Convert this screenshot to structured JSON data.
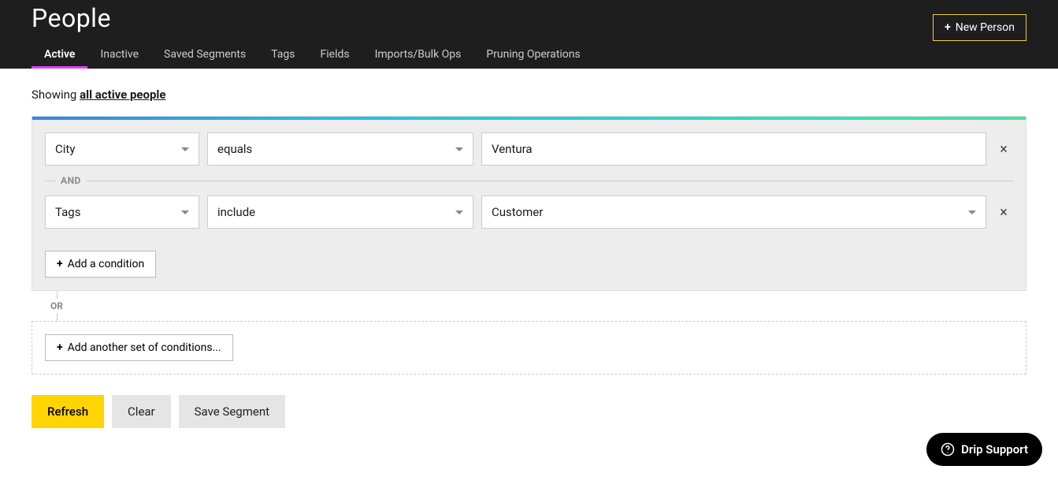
{
  "header": {
    "title": "People",
    "new_person_label": "New Person",
    "tabs": [
      "Active",
      "Inactive",
      "Saved Segments",
      "Tags",
      "Fields",
      "Imports/Bulk Ops",
      "Pruning Operations"
    ],
    "active_tab_index": 0
  },
  "showing": {
    "prefix": "Showing ",
    "link_text": "all active people"
  },
  "segment": {
    "conditions": [
      {
        "field": "City",
        "operator": "equals",
        "value": "Ventura",
        "value_type": "text"
      },
      {
        "field": "Tags",
        "operator": "include",
        "value": "Customer",
        "value_type": "dropdown"
      }
    ],
    "and_label": "AND",
    "or_label": "OR",
    "add_condition_label": "Add a condition",
    "add_set_label": "Add another set of conditions..."
  },
  "actions": {
    "refresh": "Refresh",
    "clear": "Clear",
    "save_segment": "Save Segment"
  },
  "support": {
    "label": "Drip Support"
  }
}
